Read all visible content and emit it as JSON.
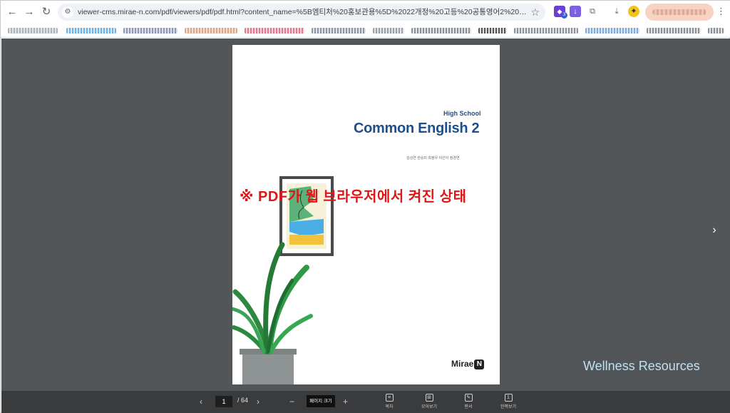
{
  "browser": {
    "url": "viewer-cms.mirae-n.com/pdf/viewers/pdf/pdf.html?content_name=%5B엠티처%20홍보관용%5D%2022개정%20고등%20공통영어2%20교과서%20P...",
    "icons": {
      "back": "←",
      "forward": "→",
      "reload": "↻",
      "site_info": "⚙",
      "bookmark_star": "☆",
      "extension_badge_count": "3",
      "download": "⤓",
      "menu": "⋮"
    }
  },
  "document": {
    "subtitle": "High School",
    "title": "Common English 2",
    "authors": "김성연 한승미 최정우 이선아 정경연",
    "publisher": "Mirae",
    "publisher_mark": "N"
  },
  "overlay_caption": "※ PDF가 웹 브라우저에서 켜진 상태",
  "watermark": "Wellness Resources",
  "viewer": {
    "next_page": "›",
    "prev_page": "‹",
    "current_page": "1",
    "total_pages": "/ 64",
    "zoom_out": "−",
    "zoom_in": "+",
    "zoom_label": "페이지 크기",
    "tools": [
      {
        "label": "목차",
        "icon": "≡"
      },
      {
        "label": "모아보기",
        "icon": "⊞"
      },
      {
        "label": "판서",
        "icon": "✎"
      },
      {
        "label": "한쪽보기",
        "icon": "1"
      }
    ]
  },
  "colors": {
    "viewer_bg": "#535659",
    "toolbar_bg": "#3a3b3d",
    "title_blue": "#1d4f8f",
    "overlay_red": "#e01515",
    "watermark": "#bfe0f4"
  }
}
